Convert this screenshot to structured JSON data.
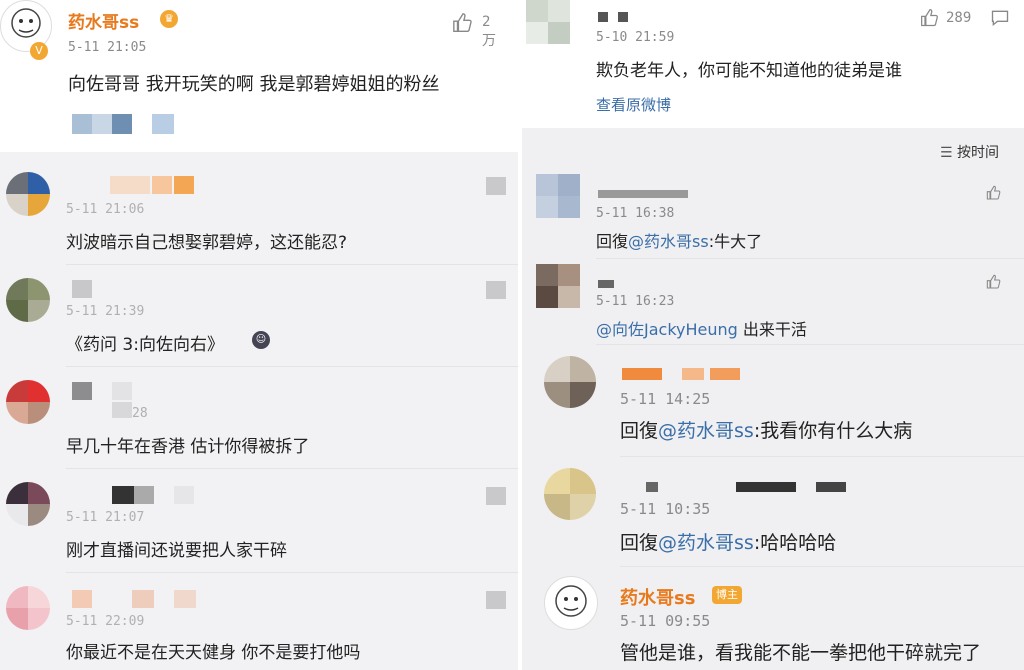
{
  "left": {
    "top_comment": {
      "name": "药水哥ss",
      "time": "5-11 21:05",
      "likes": "2万",
      "text": "向佐哥哥 我开玩笑的啊 我是郭碧婷姐姐的粉丝"
    },
    "replies": [
      {
        "time": "5-11 21:06",
        "text": "刘波暗示自己想娶郭碧婷，这还能忍?"
      },
      {
        "time": "5-11 21:39",
        "text": "《药问 3:向佐向右》"
      },
      {
        "time": "28",
        "text": "早几十年在香港 估计你得被拆了"
      },
      {
        "time": "5-11 21:07",
        "text": "刚才直播间还说要把人家干碎"
      },
      {
        "time": "5-11 22:09",
        "text": "你最近不是在天天健身 你不是要打他吗"
      }
    ]
  },
  "right": {
    "top_comment": {
      "time": "5-10 21:59",
      "likes": "289",
      "text": "欺负老年人，你可能不知道他的徒弟是谁",
      "view_original": "查看原微博"
    },
    "sort_label": "按时间",
    "replies": [
      {
        "time": "5-11 16:38",
        "prefix": "回復",
        "mention": "@药水哥ss",
        "text": ":牛大了"
      },
      {
        "time": "5-11 16:23",
        "mention": "@向佐JackyHeung",
        "text": " 出来干活"
      },
      {
        "time": "5-11 14:25",
        "prefix": "回復",
        "mention": "@药水哥ss",
        "text": ":我看你有什么大病"
      },
      {
        "time": "5-11 10:35",
        "prefix": "回復",
        "mention": "@药水哥ss",
        "text": ":哈哈哈哈"
      },
      {
        "time": "5-11 09:55",
        "name": "药水哥ss",
        "badge": "博主",
        "text": "管他是谁，看我能不能一拳把他干碎就完了"
      }
    ]
  },
  "icons": {
    "like": "thumbs-up-icon",
    "comment": "comment-icon",
    "sort": "sort-icon"
  },
  "colors": {
    "name": "#e87a1e",
    "link": "#3a6ea8",
    "badge": "#f3a733"
  }
}
